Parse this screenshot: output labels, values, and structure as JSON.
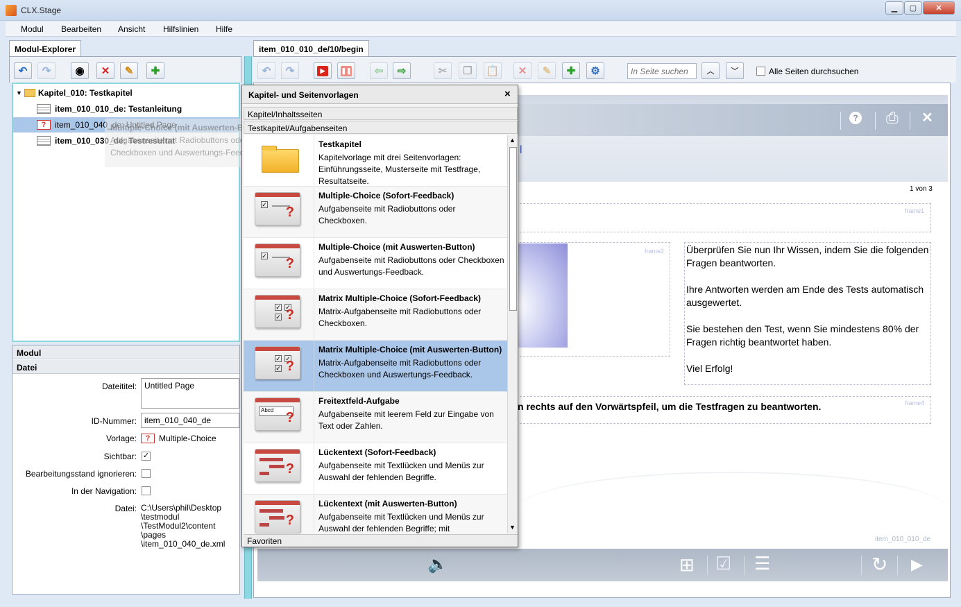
{
  "window": {
    "title": "CLX.Stage",
    "min": "▁",
    "max": "▢",
    "close": "✕"
  },
  "menu": [
    "Modul",
    "Bearbeiten",
    "Ansicht",
    "Hilfslinien",
    "Hilfe"
  ],
  "explorer": {
    "tab": "Modul-Explorer",
    "tree": {
      "chapter": "Kapitel_010: Testkapitel",
      "items": [
        {
          "label": "item_010_010_de: Testanleitung",
          "type": "doc",
          "bold": true
        },
        {
          "label": "item_010_040_de: Untitled Page",
          "type": "mc",
          "bold": false
        },
        {
          "label": "item_010_030_de: Testresultat",
          "type": "doc",
          "bold": true
        }
      ]
    },
    "ghost": {
      "title": "Multiple-Choice (mit Auswerten-Button)",
      "line1": "Aufgabenseite mit Radiobuttons oder",
      "line2": "Checkboxen und Auswertungs-Feedback."
    }
  },
  "properties": {
    "section_module": "Modul",
    "section_file": "Datei",
    "labels": {
      "title": "Dateititel:",
      "id": "ID-Nummer:",
      "template": "Vorlage:",
      "visible": "Sichtbar:",
      "ignore_state": "Bearbeitungsstand ignorieren:",
      "in_nav": "In der Navigation:",
      "file": "Datei:"
    },
    "values": {
      "title": "Untitled Page",
      "id": "item_010_040_de",
      "template": "Multiple-Choice",
      "visible": true,
      "ignore_state": false,
      "in_nav": false,
      "file_lines": [
        "C:\\Users\\phil\\Desktop",
        "\\testmodul",
        "\\TestModul2\\content",
        "\\pages",
        "\\item_010_040_de.xml"
      ]
    }
  },
  "editor": {
    "tab": "item_010_010_de/10/begin",
    "search_placeholder": "In Seite suchen",
    "search_all": "Alle Seiten durchsuchen",
    "page_counter": "1 von 3",
    "frames": [
      "frame1",
      "frame2",
      "frame4"
    ],
    "text_paragraphs": [
      "Überprüfen Sie nun Ihr Wissen, indem Sie die folgenden Fragen beantworten.",
      "Ihre Antworten werden am Ende des Tests automatisch ausgewertet.",
      "Sie bestehen den Test, wenn Sie mindestens 80% der Fragen richtig beantwortet haben.",
      "Viel Erfolg!"
    ],
    "instruction": "n rechts auf den Vorwärtspfeil, um die Testfragen zu beantworten.",
    "page_id": "item_010_010_de",
    "header_icons": {
      "help": "?",
      "print": "⎙",
      "close": "✕"
    },
    "footer_icons": {
      "sound": "🔊",
      "sitemap": "⊞",
      "check": "☑",
      "list": "☰",
      "reload": "↻",
      "next": "▶"
    },
    "stub": "l"
  },
  "popup": {
    "title": "Kapitel- und Seitenvorlagen",
    "close": "×",
    "section1": "Kapitel/Inhaltsseiten",
    "section2": "Testkapitel/Aufgabenseiten",
    "footer": "Favoriten",
    "templates": [
      {
        "title": "Testkapitel",
        "desc": "Kapitelvorlage mit drei Seitenvorlagen: Einführungsseite, Musterseite mit Testfrage, Resultatseite.",
        "thumb": "folder"
      },
      {
        "title": "Multiple-Choice (Sofort-Feedback)",
        "desc": "Aufgabenseite mit Radiobuttons oder Checkboxen.",
        "thumb": "mc"
      },
      {
        "title": "Multiple-Choice (mit Auswerten-Button)",
        "desc": "Aufgabenseite mit Radiobuttons oder Checkboxen und Auswertungs-Feedback.",
        "thumb": "mc"
      },
      {
        "title": "Matrix Multiple-Choice (Sofort-Feedback)",
        "desc": "Matrix-Aufgabenseite mit Radiobuttons oder Checkboxen.",
        "thumb": "matrix"
      },
      {
        "title": "Matrix Multiple-Choice (mit Auswerten-Button)",
        "desc": "Matrix-Aufgabenseite mit Radiobuttons oder Checkboxen und Auswertungs-Feedback.",
        "thumb": "matrix"
      },
      {
        "title": "Freitextfeld-Aufgabe",
        "desc": "Aufgabenseite mit leerem Feld zur Eingabe von Text oder Zahlen.",
        "thumb": "text"
      },
      {
        "title": "Lückentext (Sofort-Feedback)",
        "desc": "Aufgabenseite mit Textlücken und Menüs zur Auswahl der fehlenden Begriffe.",
        "thumb": "gap"
      },
      {
        "title": "Lückentext (mit Auswerten-Button)",
        "desc": "Aufgabenseite mit Textlücken und Menüs zur Auswahl der fehlenden Begriffe; mit",
        "thumb": "gap"
      }
    ],
    "thumb_text": {
      "abcd": "Abcd"
    },
    "scroll_up": "▲",
    "scroll_down": "▼"
  },
  "colors": {
    "accent": "#8ad7e1",
    "selection": "#aac7ea",
    "brand_red": "#c8291f"
  }
}
